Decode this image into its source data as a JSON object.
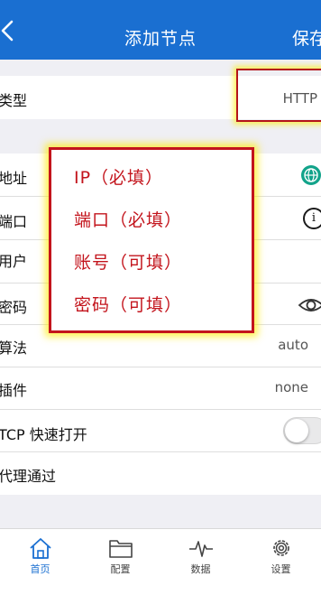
{
  "header": {
    "title": "添加节点",
    "save_label": "保存"
  },
  "rows": {
    "type": {
      "label": "类型",
      "value": "HTTP"
    },
    "address": {
      "label": "地址"
    },
    "port": {
      "label": "端口"
    },
    "user": {
      "label": "用户"
    },
    "password": {
      "label": "密码"
    },
    "algorithm": {
      "label": "算法",
      "value": "auto"
    },
    "plugin": {
      "label": "插件",
      "value": "none"
    },
    "tcp_fast_open": {
      "label": "TCP 快速打开",
      "enabled": false
    },
    "proxy_through": {
      "label": "代理通过"
    }
  },
  "icons": {
    "address": "globe-icon",
    "port": "info-icon",
    "password": "eye-icon"
  },
  "annotation": {
    "lines": [
      "IP（必填）",
      "端口（必填）",
      "账号（可填）",
      "密码（可填）"
    ]
  },
  "tabs": [
    {
      "label": "首页",
      "icon": "home-icon",
      "active": true
    },
    {
      "label": "配置",
      "icon": "folder-icon",
      "active": false
    },
    {
      "label": "数据",
      "icon": "pulse-icon",
      "active": false
    },
    {
      "label": "设置",
      "icon": "gear-icon",
      "active": false
    }
  ],
  "colors": {
    "header": "#1a6fd1",
    "annotation": "#c3141c",
    "highlight_glow": "#ffeb00",
    "globe": "#12a38a"
  }
}
